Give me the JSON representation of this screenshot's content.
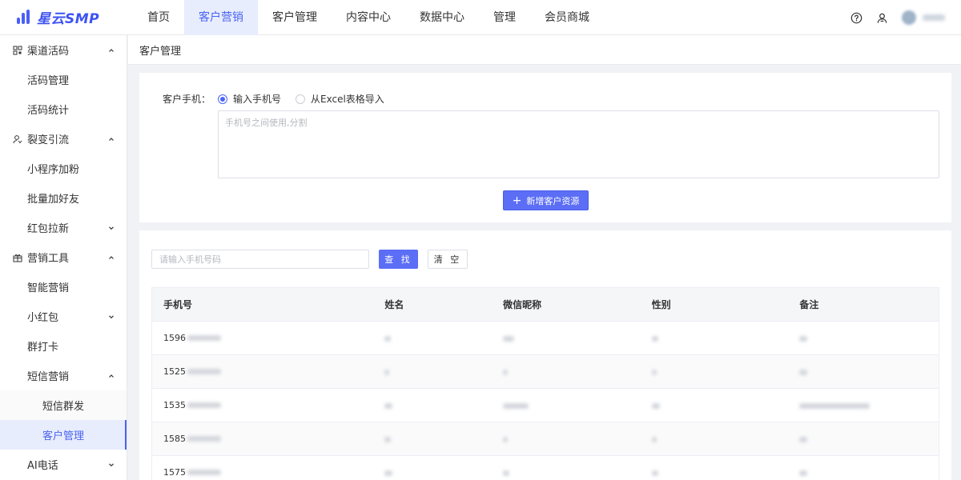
{
  "header": {
    "logo_text": "星云SMP",
    "nav": [
      {
        "label": "首页"
      },
      {
        "label": "客户营销"
      },
      {
        "label": "客户管理"
      },
      {
        "label": "内容中心"
      },
      {
        "label": "数据中心"
      },
      {
        "label": "管理"
      },
      {
        "label": "会员商城"
      }
    ],
    "active_nav": "客户营销",
    "icons": [
      "help-icon",
      "user-switch-icon"
    ],
    "accent_color": "#4a64f2"
  },
  "sidebar": {
    "groups": [
      {
        "label": "渠道活码",
        "icon": "qrcode-icon",
        "items": [
          "活码管理",
          "活码统计"
        ]
      },
      {
        "label": "裂变引流",
        "icon": "fission-icon",
        "items": [
          "小程序加粉",
          "批量加好友",
          "红包拉新"
        ]
      },
      {
        "label": "营销工具",
        "icon": "gift-icon",
        "items": [
          "智能营销",
          "小红包",
          "群打卡",
          "短信营销"
        ]
      }
    ],
    "sms_sub": [
      "短信群发",
      "客户管理"
    ],
    "ai_call": "AI电话",
    "active_item": "客户管理"
  },
  "breadcrumb": "客户管理",
  "import_form": {
    "label": "客户手机：",
    "radio_manual": "输入手机号",
    "radio_excel": "从Excel表格导入",
    "selected": "输入手机号",
    "textarea_placeholder": "手机号之间使用,分割",
    "add_button": "新增客户资源"
  },
  "search": {
    "placeholder": "请输入手机号码",
    "find_button": "查 找",
    "clear_button": "清 空"
  },
  "table": {
    "headers": [
      "手机号",
      "姓名",
      "微信昵称",
      "性别",
      "备注"
    ],
    "rows": [
      {
        "phone": "1596"
      },
      {
        "phone": "1525"
      },
      {
        "phone": "1535"
      },
      {
        "phone": "1585"
      },
      {
        "phone": "1575"
      }
    ]
  }
}
